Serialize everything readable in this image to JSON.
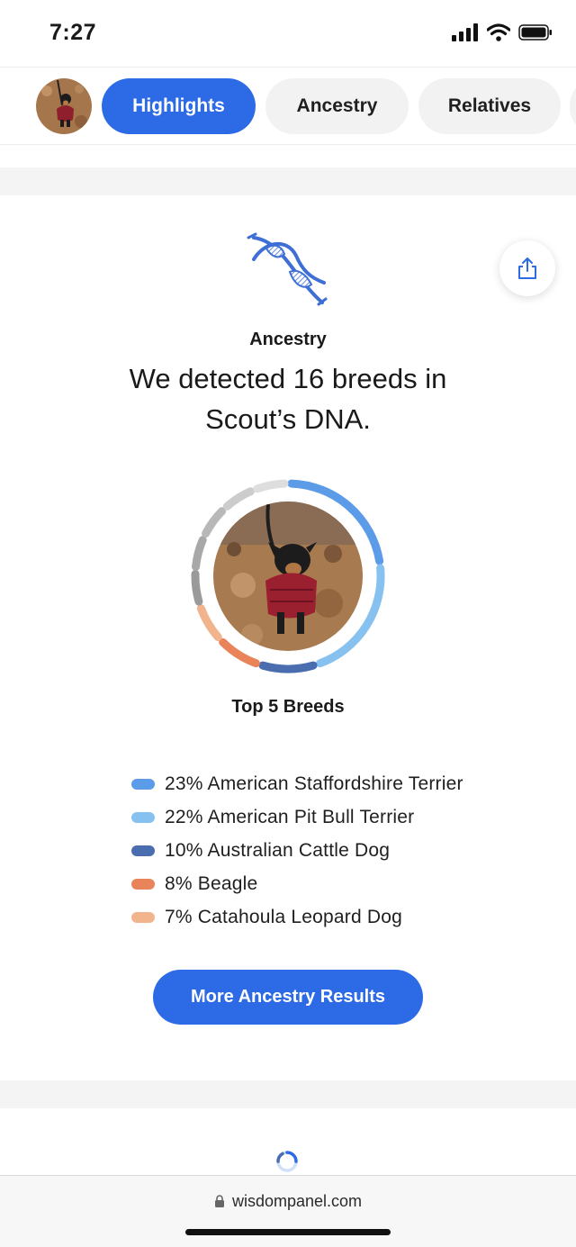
{
  "status_bar": {
    "time": "7:27",
    "icons": [
      "cellular-signal-icon",
      "wifi-icon",
      "battery-icon"
    ]
  },
  "tabs": [
    {
      "label": "Highlights",
      "active": true
    },
    {
      "label": "Ancestry",
      "active": false
    },
    {
      "label": "Relatives",
      "active": false
    }
  ],
  "ancestry": {
    "section_label": "Ancestry",
    "headline_line1": "We detected 16 breeds in",
    "headline_line2": "Scout’s DNA.",
    "top_breeds_title": "Top 5 Breeds",
    "breeds": [
      {
        "label": "23% American Staffordshire Terrier",
        "percent": 23,
        "color": "#5b9be8"
      },
      {
        "label": "22% American Pit Bull Terrier",
        "percent": 22,
        "color": "#87c1ef"
      },
      {
        "label": "10% Australian Cattle Dog",
        "percent": 10,
        "color": "#4a6db0"
      },
      {
        "label": "8% Beagle",
        "percent": 8,
        "color": "#e8835a"
      },
      {
        "label": "7% Catahoula Leopard Dog",
        "percent": 7,
        "color": "#f1b48d"
      }
    ],
    "cta_label": "More Ancestry Results"
  },
  "colors": {
    "accent": "#2c6ae6",
    "band_gray": "#f4f4f4"
  },
  "browser": {
    "url": "wisdompanel.com"
  }
}
